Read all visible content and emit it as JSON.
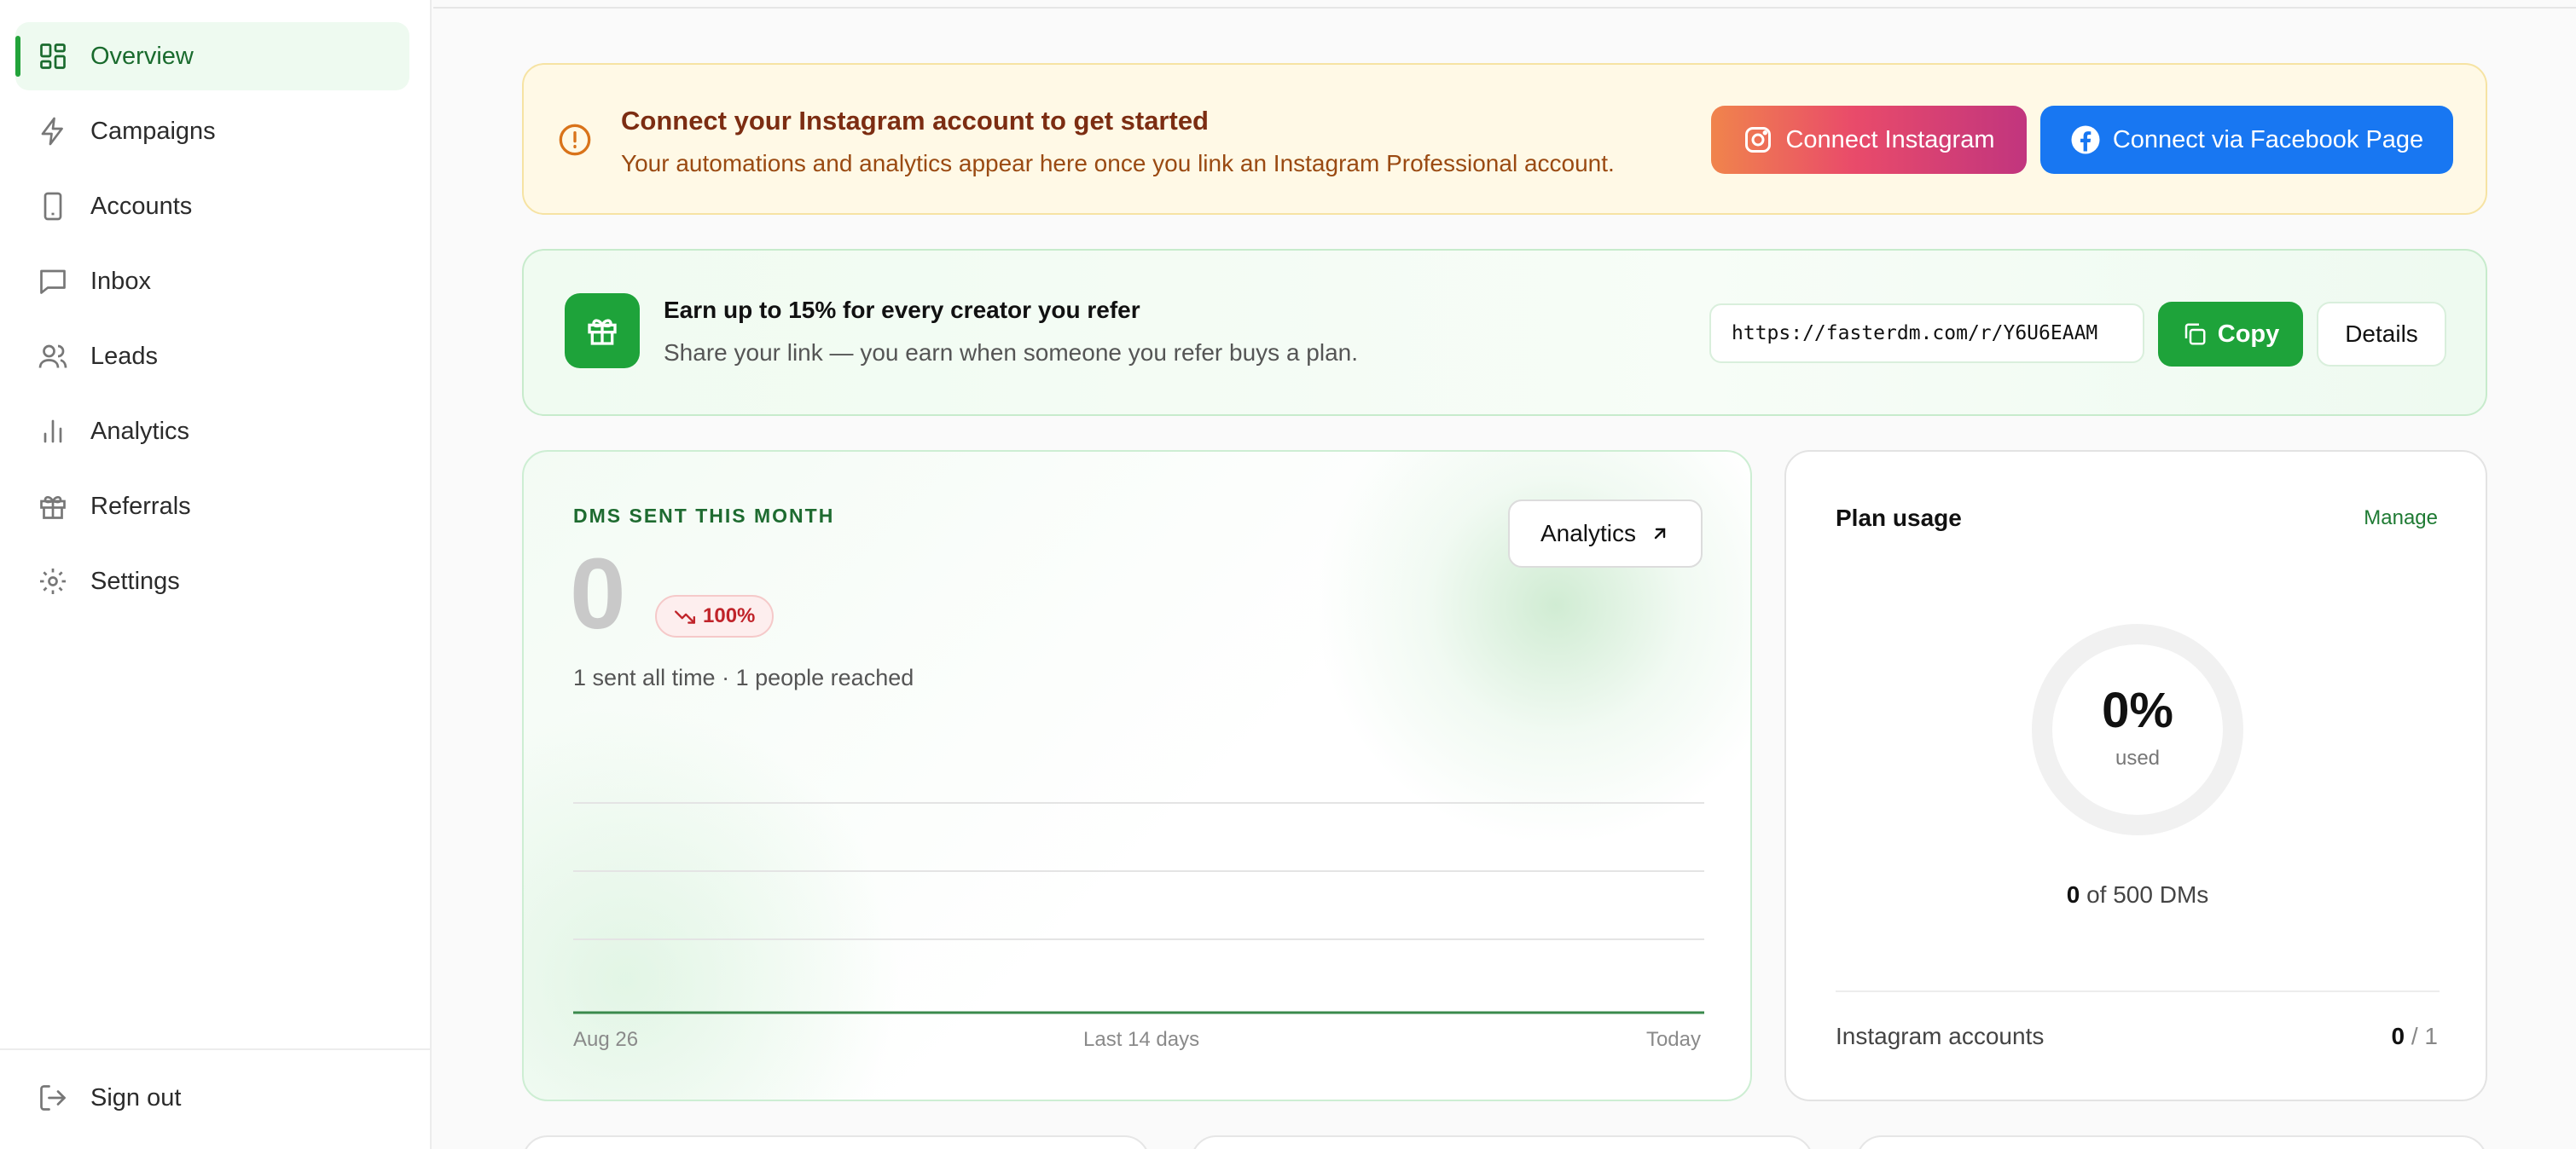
{
  "sidebar": {
    "items": [
      {
        "label": "Overview",
        "icon": "layout-grid-icon",
        "active": true
      },
      {
        "label": "Campaigns",
        "icon": "lightning-icon"
      },
      {
        "label": "Accounts",
        "icon": "phone-icon"
      },
      {
        "label": "Inbox",
        "icon": "chat-icon"
      },
      {
        "label": "Leads",
        "icon": "users-icon"
      },
      {
        "label": "Analytics",
        "icon": "bar-chart-icon"
      },
      {
        "label": "Referrals",
        "icon": "gift-icon"
      },
      {
        "label": "Settings",
        "icon": "gear-icon"
      }
    ],
    "signout_label": "Sign out"
  },
  "alert": {
    "title": "Connect your Instagram account to get started",
    "subtitle": "Your automations and analytics appear here once you link an Instagram Professional account.",
    "connect_instagram_label": "Connect Instagram",
    "connect_facebook_label": "Connect via Facebook Page"
  },
  "referral": {
    "title": "Earn up to 15% for every creator you refer",
    "subtitle": "Share your link — you earn when someone you refer buys a plan.",
    "link": "https://fasterdm.com/r/Y6U6EAAM",
    "copy_label": "Copy",
    "details_label": "Details"
  },
  "dms": {
    "label": "DMS SENT THIS MONTH",
    "value": "0",
    "trend": "100%",
    "subtitle": "1 sent all time · 1 people reached",
    "analytics_button": "Analytics"
  },
  "chart_data": {
    "type": "line",
    "x_labels": [
      "Aug 26",
      "Last 14 days",
      "Today"
    ],
    "series": [
      {
        "values": [
          0,
          0,
          0,
          0,
          0,
          0,
          0,
          0,
          0,
          0,
          0,
          0,
          0,
          0
        ]
      }
    ],
    "grid": true
  },
  "plan": {
    "title": "Plan usage",
    "manage_label": "Manage",
    "used_fraction": 0,
    "percent_text": "0%",
    "used_label": "used",
    "dms_used": "0",
    "dms_of_text": "of 500 DMs",
    "ig_accounts_label": "Instagram accounts",
    "ig_accounts_used": "0",
    "ig_accounts_limit": "/ 1"
  },
  "colors": {
    "accent": "#1ea33a",
    "alert_bg": "#fff9e6",
    "alert_text": "#7c2d12",
    "facebook": "#1877f2",
    "trend_down": "#c0242a"
  }
}
